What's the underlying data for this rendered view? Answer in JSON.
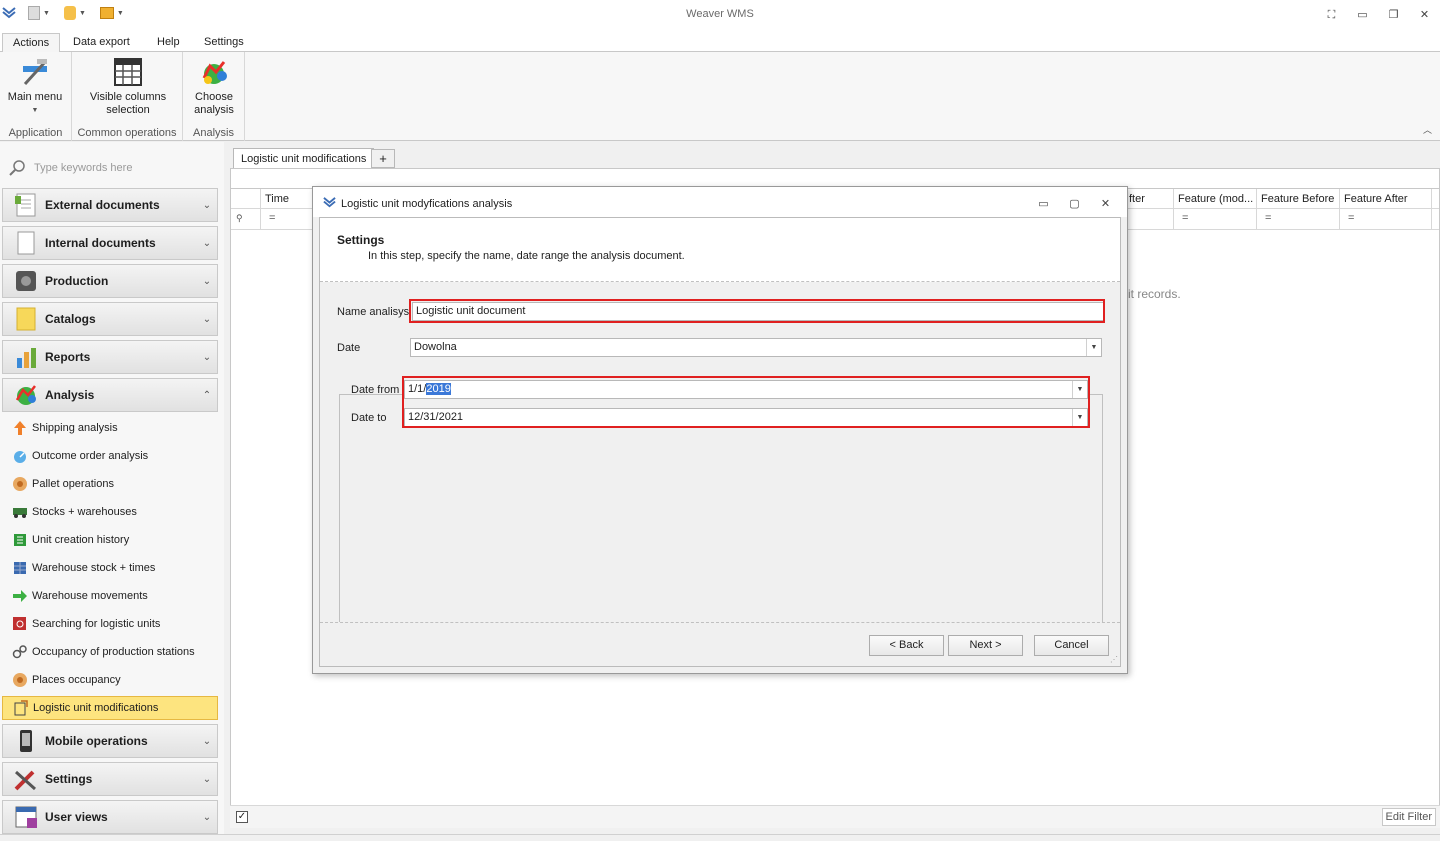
{
  "app": {
    "title": "Weaver WMS"
  },
  "menu_tabs": [
    "Actions",
    "Data export",
    "Help",
    "Settings"
  ],
  "ribbon": {
    "main_menu": "Main menu",
    "visible_columns_1": "Visible columns",
    "visible_columns_2": "selection",
    "choose_analysis_1": "Choose",
    "choose_analysis_2": "analysis",
    "group_application": "Application",
    "group_common": "Common operations",
    "group_analysis": "Analysis"
  },
  "sidebar": {
    "search_placeholder": "Type keywords here",
    "groups": [
      "External documents",
      "Internal documents",
      "Production",
      "Catalogs",
      "Reports",
      "Analysis",
      "Mobile operations",
      "Settings",
      "User views"
    ],
    "analysis_items": [
      "Shipping analysis",
      "Outcome order analysis",
      "Pallet operations",
      "Stocks + warehouses",
      "Unit creation history",
      "Warehouse stock + times",
      "Warehouse movements",
      "Searching for logistic units",
      "Occupancy of production stations",
      "Places occupancy",
      "Logistic unit modifications"
    ]
  },
  "document_tab": "Logistic unit modifications",
  "add_tab": "+",
  "grid": {
    "columns": [
      "Time",
      "fter",
      "Feature (mod...",
      "Feature Before",
      "Feature After"
    ],
    "filter_symbol": "=",
    "empty_text": "it records."
  },
  "bottom": {
    "edit_filter": "Edit Filter",
    "check": "✓"
  },
  "dialog": {
    "title": "Logistic unit modyfications analysis",
    "heading": "Settings",
    "subheading": "In this step, specify the name, date range the analysis document.",
    "name_label": "Name analisys",
    "name_value": "Logistic unit document",
    "date_label": "Date",
    "date_value": "Dowolna",
    "date_from_label": "Date from",
    "date_from_prefix": "1/1/",
    "date_from_selected": "2019",
    "date_to_label": "Date to",
    "date_to_value": "12/31/2021",
    "back": "< Back",
    "next": "Next >",
    "cancel": "Cancel"
  },
  "colors": {
    "highlight": "#e02020",
    "selected_item": "#fde47f",
    "selection": "#3b78d8"
  }
}
